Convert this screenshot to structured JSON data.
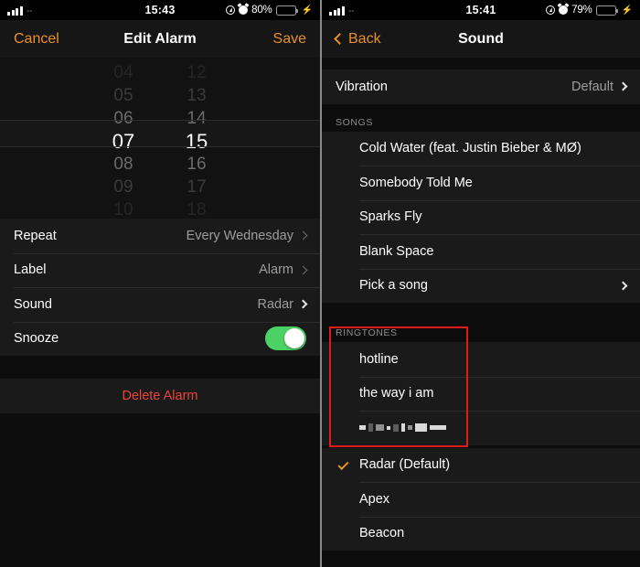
{
  "left_screen": {
    "status_bar": {
      "time": "15:43",
      "battery_percent": "80%",
      "battery_color": "#4cd264",
      "icons": [
        "signal-bars-icon",
        "location-icon",
        "alarm-icon",
        "battery-icon",
        "charging-bolt-icon"
      ]
    },
    "nav": {
      "cancel_label": "Cancel",
      "title": "Edit Alarm",
      "save_label": "Save"
    },
    "picker": {
      "hours": [
        "04",
        "05",
        "06",
        "07",
        "08",
        "09",
        "10"
      ],
      "minutes": [
        "12",
        "13",
        "14",
        "15",
        "16",
        "17",
        "18"
      ],
      "selected_hour": "07",
      "selected_minute": "15"
    },
    "settings": [
      {
        "label": "Repeat",
        "value": "Every Wednesday",
        "chevron": true
      },
      {
        "label": "Label",
        "value": "Alarm",
        "chevron": true
      },
      {
        "label": "Sound",
        "value": "Radar",
        "chevron": true
      },
      {
        "label": "Snooze",
        "value": "",
        "toggle_on": true
      }
    ],
    "delete_label": "Delete Alarm",
    "delete_color": "#e8453c"
  },
  "right_screen": {
    "status_bar": {
      "time": "15:41",
      "battery_percent": "79%",
      "battery_color": "#e8c02a",
      "icons": [
        "signal-bars-icon",
        "location-icon",
        "alarm-icon",
        "battery-icon",
        "charging-bolt-icon"
      ]
    },
    "nav": {
      "back_label": "Back",
      "title": "Sound"
    },
    "vibration": {
      "label": "Vibration",
      "value": "Default"
    },
    "songs_header": "SONGS",
    "songs": [
      {
        "label": "Cold Water (feat. Justin Bieber & MØ)",
        "chevron": false
      },
      {
        "label": "Somebody Told Me",
        "chevron": false
      },
      {
        "label": "Sparks Fly",
        "chevron": false
      },
      {
        "label": "Blank Space",
        "chevron": false
      },
      {
        "label": "Pick a song",
        "chevron": true
      }
    ],
    "ringtones_header": "RINGTONES",
    "custom_ringtones": [
      {
        "label": "hotline",
        "redacted": false
      },
      {
        "label": "the way i am",
        "redacted": false
      },
      {
        "label": "",
        "redacted": true
      }
    ],
    "system_ringtones": [
      {
        "label": "Radar (Default)",
        "checked": true
      },
      {
        "label": "Apex",
        "checked": false
      },
      {
        "label": "Beacon",
        "checked": false
      }
    ],
    "highlight_color": "#e11b1b",
    "accent_color": "#e8912a"
  }
}
